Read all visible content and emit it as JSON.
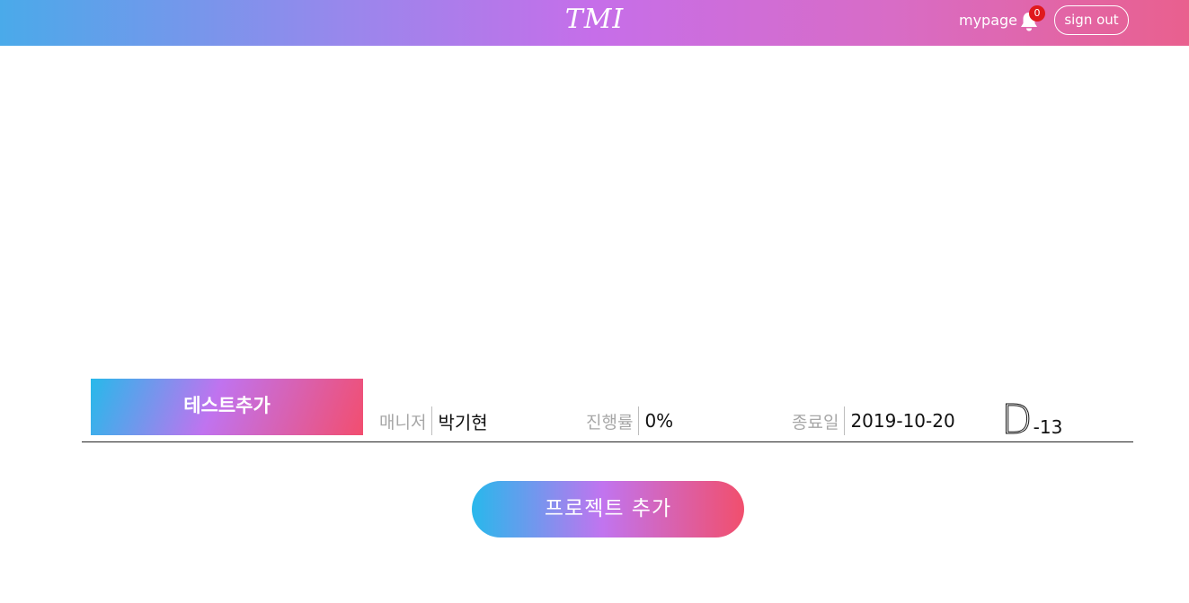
{
  "header": {
    "logo": "TMI",
    "mypage_label": "mypage",
    "notification_count": "0",
    "signout_label": "sign out"
  },
  "project": {
    "name": "테스트추가",
    "manager_label": "매니저",
    "manager_value": "박기현",
    "progress_label": "진행률",
    "progress_value": "0%",
    "end_label": "종료일",
    "end_value": "2019-10-20",
    "dday_letter": "D",
    "dday_value": "-13"
  },
  "add_project_label": "프로젝트 추가",
  "icons": {
    "bell": "bell-icon"
  },
  "colors": {
    "header_gradient": [
      "#4aaaea",
      "#c66ee9",
      "#e9608e"
    ],
    "button_gradient": [
      "#28b8ec",
      "#c174ef",
      "#f14f6d"
    ],
    "badge": "#e0191d"
  }
}
